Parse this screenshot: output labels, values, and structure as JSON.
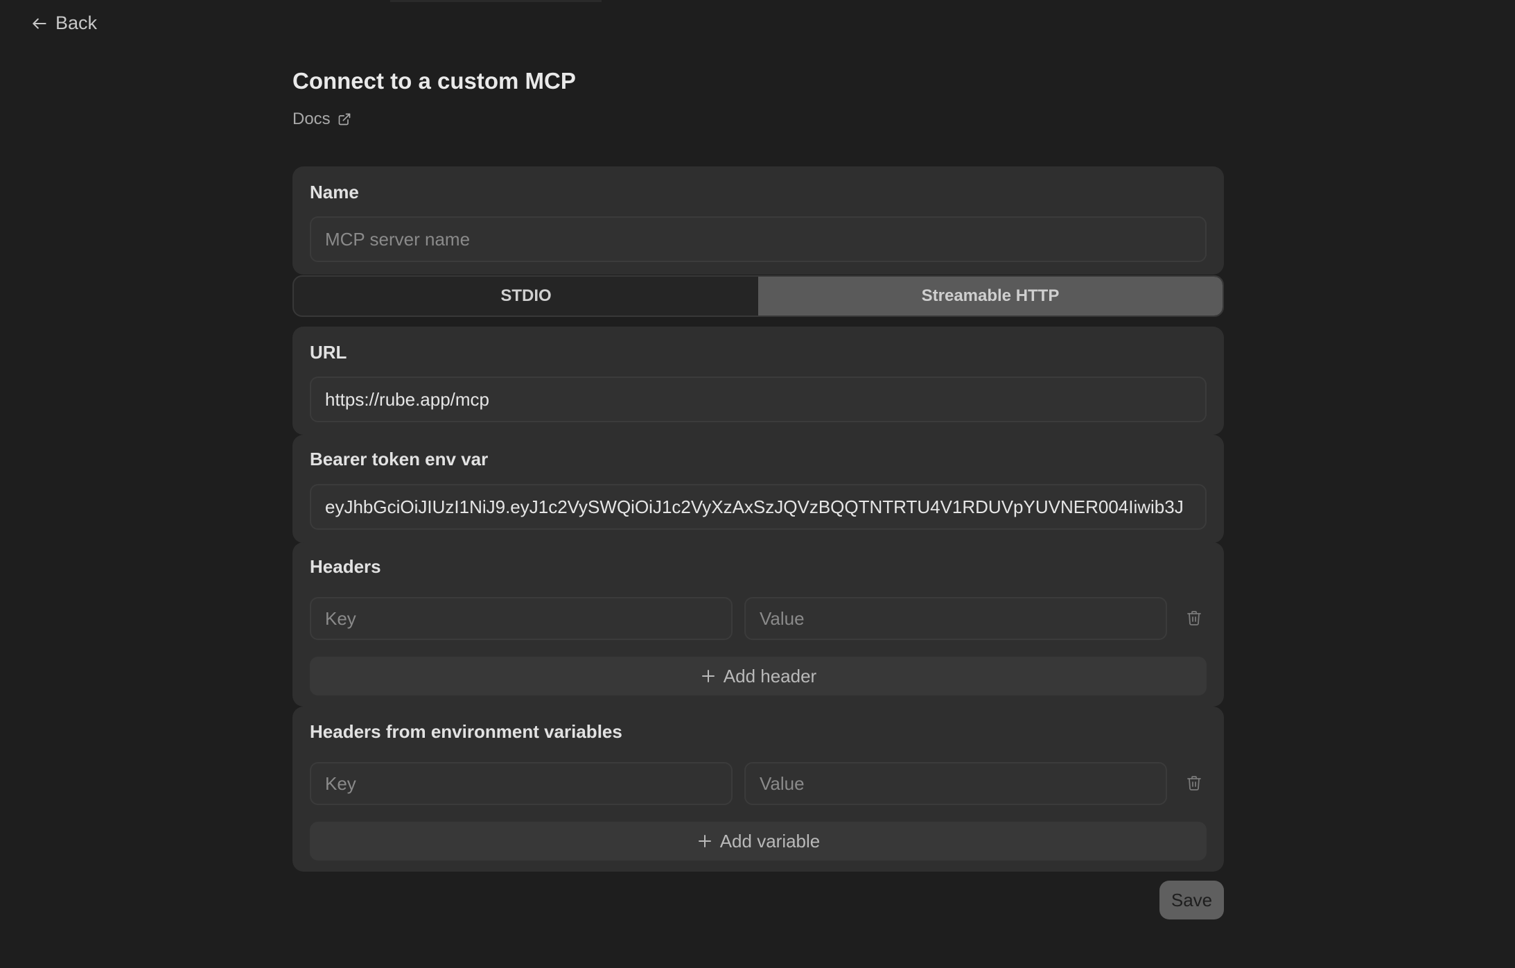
{
  "nav": {
    "back_label": "Back"
  },
  "page": {
    "title": "Connect to a custom MCP",
    "docs_label": "Docs"
  },
  "name_section": {
    "label": "Name",
    "placeholder": "MCP server name",
    "value": ""
  },
  "transport": {
    "options": [
      "STDIO",
      "Streamable HTTP"
    ],
    "selected": "Streamable HTTP"
  },
  "url_section": {
    "label": "URL",
    "value": "https://rube.app/mcp"
  },
  "bearer_section": {
    "label": "Bearer token env var",
    "value": "eyJhbGciOiJIUzI1NiJ9.eyJ1c2VySWQiOiJ1c2VyXzAxSzJQVzBQQTNTRTU4V1RDUVpYUVNER004Iiwib3J"
  },
  "headers_section": {
    "label": "Headers",
    "key_placeholder": "Key",
    "value_placeholder": "Value",
    "add_label": "Add header"
  },
  "env_headers_section": {
    "label": "Headers from environment variables",
    "key_placeholder": "Key",
    "value_placeholder": "Value",
    "add_label": "Add variable"
  },
  "actions": {
    "save_label": "Save"
  },
  "colors": {
    "background": "#1e1e1e",
    "card": "#2f2f2f",
    "toggle_active": "#5a5a5a",
    "save_button": "#5f5f5f"
  },
  "icons": [
    "arrow-left-icon",
    "external-link-icon",
    "trash-icon",
    "plus-icon"
  ]
}
